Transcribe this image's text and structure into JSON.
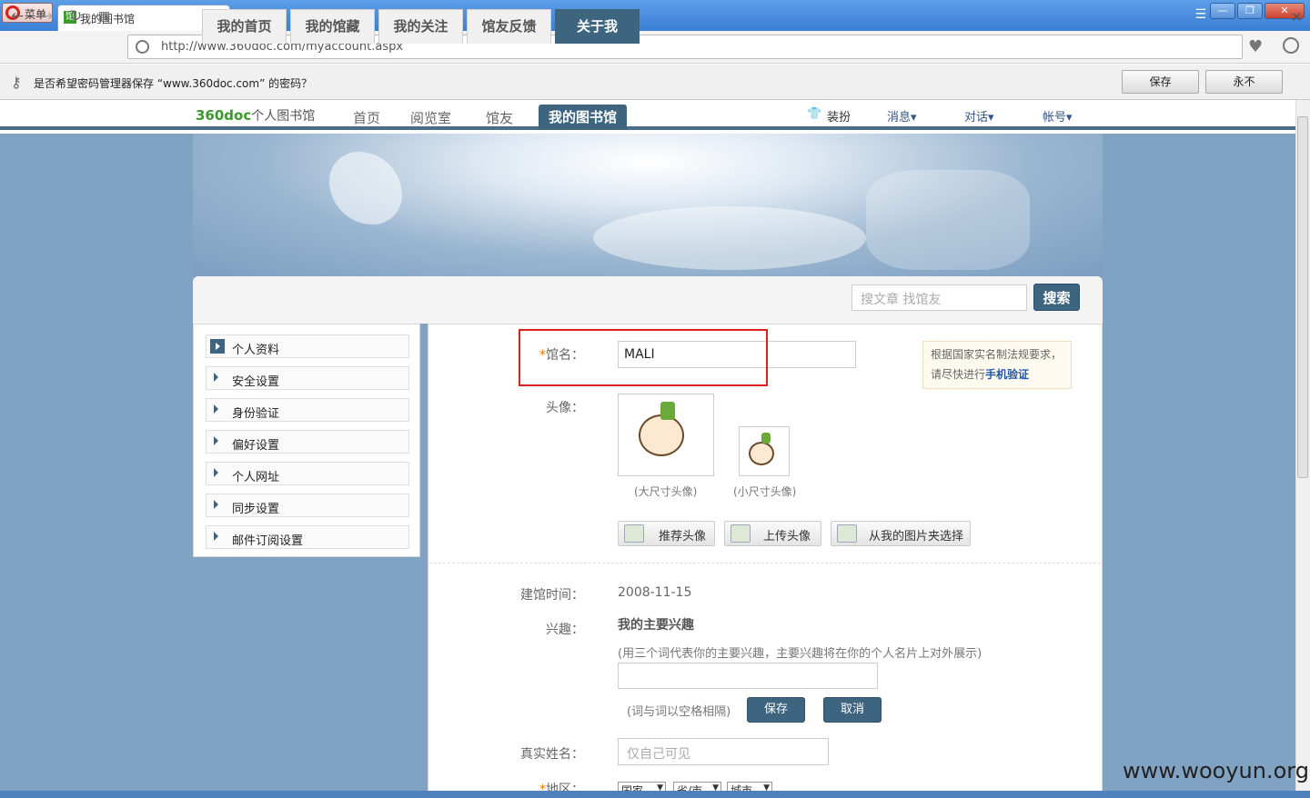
{
  "browser": {
    "menu_label": "菜单",
    "tab_title": "我的图书馆",
    "tab_icon": "馆",
    "url": "http://www.360doc.com/myaccount.aspx",
    "password_prompt": "是否希望密码管理器保存 “www.360doc.com” 的密码？",
    "save_label": "保存",
    "never_label": "永不"
  },
  "site": {
    "brand": "360doc",
    "brand_sub": "个人图书馆",
    "nav": [
      "首页",
      "阅览室",
      "馆友"
    ],
    "nav_active": "我的图书馆",
    "top_right": [
      "装扮",
      "消息▾",
      "对话▾",
      "帐号▾"
    ]
  },
  "tabs": [
    "我的首页",
    "我的馆藏",
    "我的关注",
    "馆友反馈",
    "关于我"
  ],
  "search": {
    "placeholder": "搜文章 找馆友",
    "button": "搜索"
  },
  "sidebar": [
    "个人资料",
    "安全设置",
    "身份验证",
    "偏好设置",
    "个人网址",
    "同步设置",
    "邮件订阅设置"
  ],
  "form": {
    "name_label": "馆名：",
    "name_value": "MALI",
    "avatar_label": "头像：",
    "avatar_big": "(大尺寸头像)",
    "avatar_small": "(小尺寸头像)",
    "notice_line1": "根据国家实名制法规要求，",
    "notice_line2": "请尽快进行",
    "notice_link": "手机验证",
    "btn_recommend": "推荐头像",
    "btn_upload": "上传头像",
    "btn_pick": "从我的图片夹选择",
    "created_label": "建馆时间：",
    "created_value": "2008-11-15",
    "interest_label": "兴趣：",
    "interest_title": "我的主要兴趣",
    "interest_hint": "(用三个词代表你的主要兴趣，主要兴趣将在你的个人名片上对外展示)",
    "interest_sep": "(词与词以空格相隔)",
    "save": "保存",
    "cancel": "取消",
    "realname_label": "真实姓名：",
    "realname_placeholder": "仅自己可见",
    "region_label": "地区：",
    "region": [
      "国家",
      "省/市",
      "城市"
    ]
  },
  "watermark": "www.wooyun.org"
}
